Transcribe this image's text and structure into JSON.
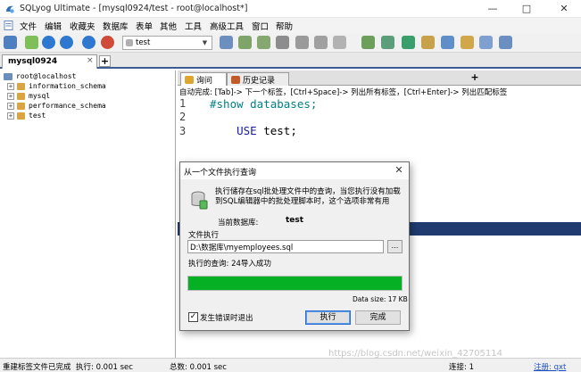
{
  "window": {
    "title": "SQLyog Ultimate - [mysql0924/test - root@localhost*]",
    "minimize_glyph": "—",
    "maximize_glyph": "□",
    "close_glyph": "✕"
  },
  "menu": [
    "文件",
    "编辑",
    "收藏夹",
    "数据库",
    "表单",
    "其他",
    "工具",
    "高级工具",
    "窗口",
    "帮助"
  ],
  "toolbar": {
    "database_select": "test"
  },
  "connection_tabs": {
    "active": "mysql0924",
    "close_glyph": "×",
    "add_glyph": "+"
  },
  "object_browser": {
    "root": "root@localhost",
    "databases": [
      "information_schema",
      "mysql",
      "performance_schema",
      "test"
    ]
  },
  "query_tabs": [
    {
      "label": "询问"
    },
    {
      "label": "历史记录"
    }
  ],
  "query_tab_add": "+",
  "hint": "自动完成: [Tab]-> 下一个标签，[Ctrl+Space]-> 列出所有标签，[Ctrl+Enter]-> 列出匹配标签",
  "editor": {
    "line_numbers": [
      "1",
      "2",
      "3"
    ],
    "lines": [
      "#show databases;",
      "USE test;"
    ]
  },
  "dialog": {
    "title": "从一个文件执行查询",
    "close_glyph": "✕",
    "description": "执行储存在sql批处理文件中的查询，当您执行没有加载到SQL编辑器中的批处理脚本时，这个选项非常有用",
    "current_db_label": "当前数据库:",
    "current_db_value": "test",
    "file_label": "文件执行",
    "file_path": "D:\\数据库\\myemployees.sql",
    "browse_label": "...",
    "status": "执行的查询: 24导入成功",
    "progress": 1.0,
    "progress_color": "#06b025",
    "data_size": "Data size: 17 KB",
    "checkbox_label": "发生错误时退出",
    "checkbox_checked": true,
    "execute_label": "执行",
    "done_label": "完成"
  },
  "statusbar": {
    "message": "重建标签文件已完成",
    "exec_time": "执行: 0.001 sec",
    "total_time": "总数: 0.001 sec",
    "connection": "连接: 1",
    "register": "注册: qxt"
  },
  "watermark": "https://blog.csdn.net/weixin_42705114"
}
